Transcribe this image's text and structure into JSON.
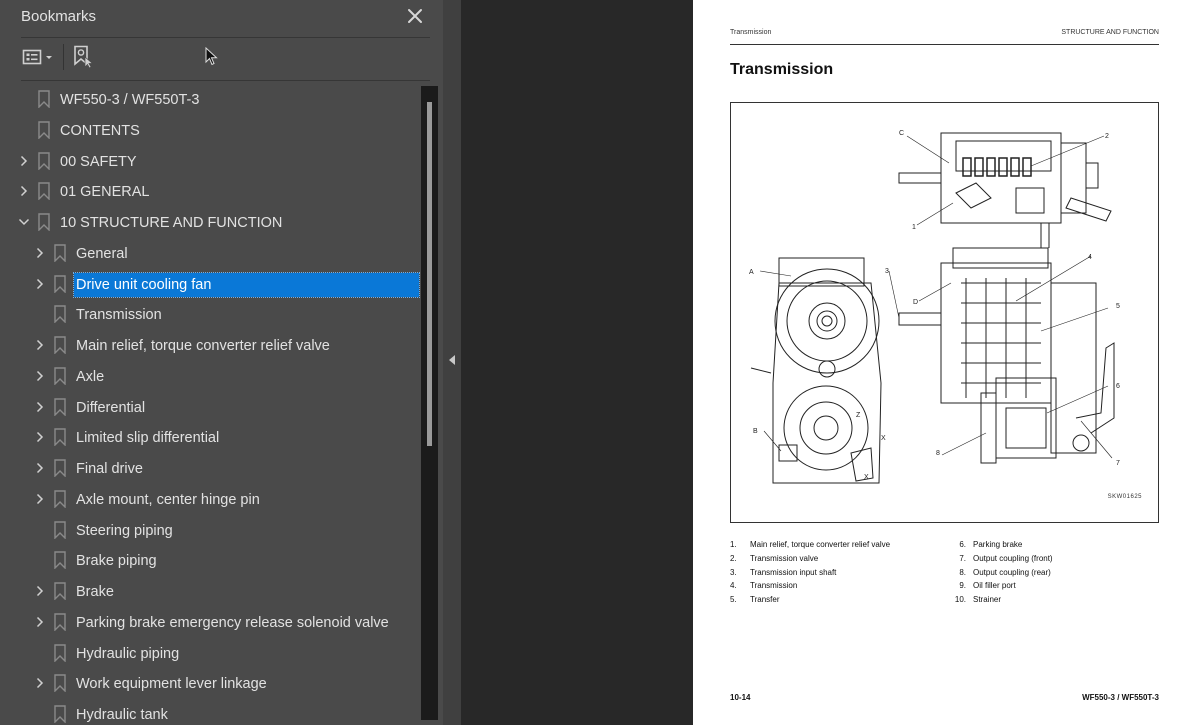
{
  "bookmarks_panel": {
    "title": "Bookmarks",
    "close_label": "Close",
    "toolbar": {
      "options_icon": "list-options-icon",
      "find_current_icon": "find-current-bookmark-icon"
    },
    "selected_index": 6,
    "items": [
      {
        "label": "WF550-3 / WF550T-3",
        "level": 0,
        "expander": "none"
      },
      {
        "label": "CONTENTS",
        "level": 0,
        "expander": "none"
      },
      {
        "label": "00 SAFETY",
        "level": 0,
        "expander": "collapsed"
      },
      {
        "label": "01 GENERAL",
        "level": 0,
        "expander": "collapsed"
      },
      {
        "label": "10 STRUCTURE AND FUNCTION",
        "level": 0,
        "expander": "expanded"
      },
      {
        "label": "General",
        "level": 1,
        "expander": "collapsed"
      },
      {
        "label": "Drive unit cooling fan",
        "level": 1,
        "expander": "collapsed"
      },
      {
        "label": "Transmission",
        "level": 1,
        "expander": "none"
      },
      {
        "label": "Main relief, torque converter relief valve",
        "level": 1,
        "expander": "collapsed"
      },
      {
        "label": "Axle",
        "level": 1,
        "expander": "collapsed"
      },
      {
        "label": "Differential",
        "level": 1,
        "expander": "collapsed"
      },
      {
        "label": "Limited slip differential",
        "level": 1,
        "expander": "collapsed"
      },
      {
        "label": "Final drive",
        "level": 1,
        "expander": "collapsed"
      },
      {
        "label": "Axle mount, center hinge pin",
        "level": 1,
        "expander": "collapsed"
      },
      {
        "label": "Steering piping",
        "level": 1,
        "expander": "none"
      },
      {
        "label": "Brake piping",
        "level": 1,
        "expander": "none"
      },
      {
        "label": "Brake",
        "level": 1,
        "expander": "collapsed"
      },
      {
        "label": "Parking brake emergency release solenoid valve",
        "level": 1,
        "expander": "collapsed"
      },
      {
        "label": "Hydraulic piping",
        "level": 1,
        "expander": "none"
      },
      {
        "label": "Work equipment lever linkage",
        "level": 1,
        "expander": "collapsed"
      },
      {
        "label": "Hydraulic tank",
        "level": 1,
        "expander": "none"
      }
    ]
  },
  "page": {
    "header_left": "Transmission",
    "header_right": "STRUCTURE AND FUNCTION",
    "title": "Transmission",
    "figure_code": "SKW01625",
    "figure_callouts": [
      "A",
      "B",
      "C",
      "D",
      "X",
      "Z",
      "1",
      "2",
      "3",
      "4",
      "5",
      "6",
      "7",
      "8"
    ],
    "legend_left": [
      {
        "num": "1.",
        "text": "Main relief, torque converter relief valve"
      },
      {
        "num": "2.",
        "text": "Transmission valve"
      },
      {
        "num": "3.",
        "text": "Transmission input shaft"
      },
      {
        "num": "4.",
        "text": "Transmission"
      },
      {
        "num": "5.",
        "text": "Transfer"
      }
    ],
    "legend_right": [
      {
        "num": "6.",
        "text": "Parking brake"
      },
      {
        "num": "7.",
        "text": "Output coupling (front)"
      },
      {
        "num": "8.",
        "text": "Output coupling (rear)"
      },
      {
        "num": "9.",
        "text": "Oil filler port"
      },
      {
        "num": "10.",
        "text": "Strainer"
      }
    ],
    "footer_left": "10-14",
    "footer_right": "WF550-3 / WF550T-3"
  },
  "colors": {
    "panel_bg": "#4a4a4a",
    "selection": "#0a78d7",
    "doc_bg": "#282828"
  }
}
